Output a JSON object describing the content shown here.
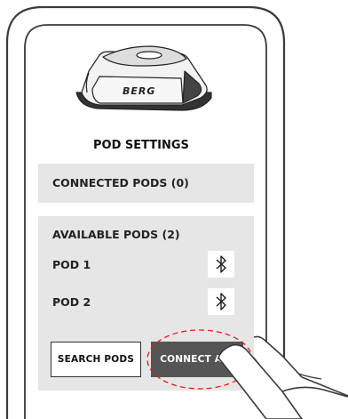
{
  "device": {
    "brand_text": "BERG"
  },
  "page": {
    "title": "POD SETTINGS"
  },
  "connected": {
    "label": "CONNECTED PODS (0)"
  },
  "available": {
    "label": "AVAILABLE PODS (2)",
    "pods": [
      {
        "name": "POD 1",
        "icon": "bluetooth-icon"
      },
      {
        "name": "POD 2",
        "icon": "bluetooth-icon"
      }
    ]
  },
  "actions": {
    "search_label": "SEARCH PODS",
    "connect_all_label": "CONNECT ALL"
  },
  "colors": {
    "panel": "#e6e6e6",
    "connect_button": "#555555",
    "highlight": "#e02020"
  }
}
